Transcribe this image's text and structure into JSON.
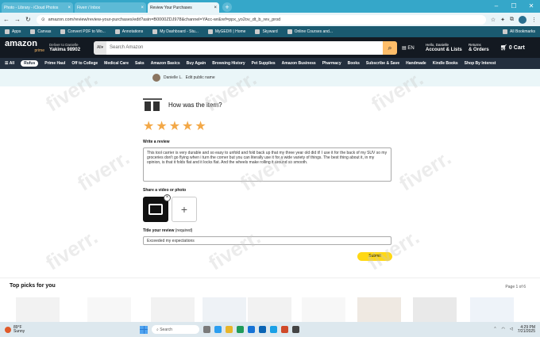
{
  "browser": {
    "tabs": [
      {
        "label": "Photo - Library - iCloud Photos",
        "active": false
      },
      {
        "label": "Fiverr / Inbox",
        "active": false
      },
      {
        "label": "Review Your Purchases",
        "active": true
      }
    ],
    "url": "amazon.com/review/review-your-purchases/edit?asin=B0000ZDJ978&channel=YAcc-wr&ref=ppx_yo2ov_dt_b_rev_prod",
    "bookmarks": [
      "Apps",
      "Canvas",
      "Convert PDF to Wo...",
      "Annotations",
      "My Dashboard - Stu...",
      "MyGED® | Home",
      "Skyward",
      "Online Courses and..."
    ],
    "all_bookmarks": "All Bookmarks"
  },
  "amazon": {
    "logo": "amazon",
    "logo_sub": "prime",
    "deliver_line1": "Deliver to Danielle",
    "deliver_line2": "Yakima 98902",
    "search_category": "All",
    "search_placeholder": "Search Amazon",
    "lang": "EN",
    "account_line1": "Hello, Danielle",
    "account_line2": "Account & Lists",
    "returns_line1": "Returns",
    "returns_line2": "& Orders",
    "cart_count": "0",
    "cart_label": "Cart",
    "nav": [
      "All",
      "Rufus",
      "Prime Haul",
      "Off to College",
      "Medical Care",
      "Saks",
      "Amazon Basics",
      "Buy Again",
      "Browsing History",
      "Pet Supplies",
      "Amazon Business",
      "Pharmacy",
      "Books",
      "Subscribe & Save",
      "Handmade",
      "Kindle Books",
      "Shop By Interest"
    ]
  },
  "profile": {
    "name": "Danielle L.",
    "edit_link": "Edit public name"
  },
  "review": {
    "question": "How was the item?",
    "rating": 5,
    "write_label": "Write a review",
    "text": "This tool carrier is very durable and so easy to unfold and fold back up that my three year old did it! I use it for the back of my SUV so my groceries don't go flying when i turn the corner but you can literally use it for a wide variety of things. The best thing about it, in my opinion, is that it folds flat and it locks flat. And the wheels make rolling it around so smooth.",
    "media_label": "Share a video or photo",
    "title_label": "Title your review",
    "title_required": "(required)",
    "title_value": "Exceeded my expectations",
    "submit": "Submit"
  },
  "picks": {
    "heading": "Top picks for you",
    "page": "Page 1 of 6"
  },
  "taskbar": {
    "temp": "89°F",
    "weather": "Sunny",
    "search": "Search",
    "time": "4:29 PM",
    "date": "7/21/2025"
  },
  "watermark": "fiverr."
}
